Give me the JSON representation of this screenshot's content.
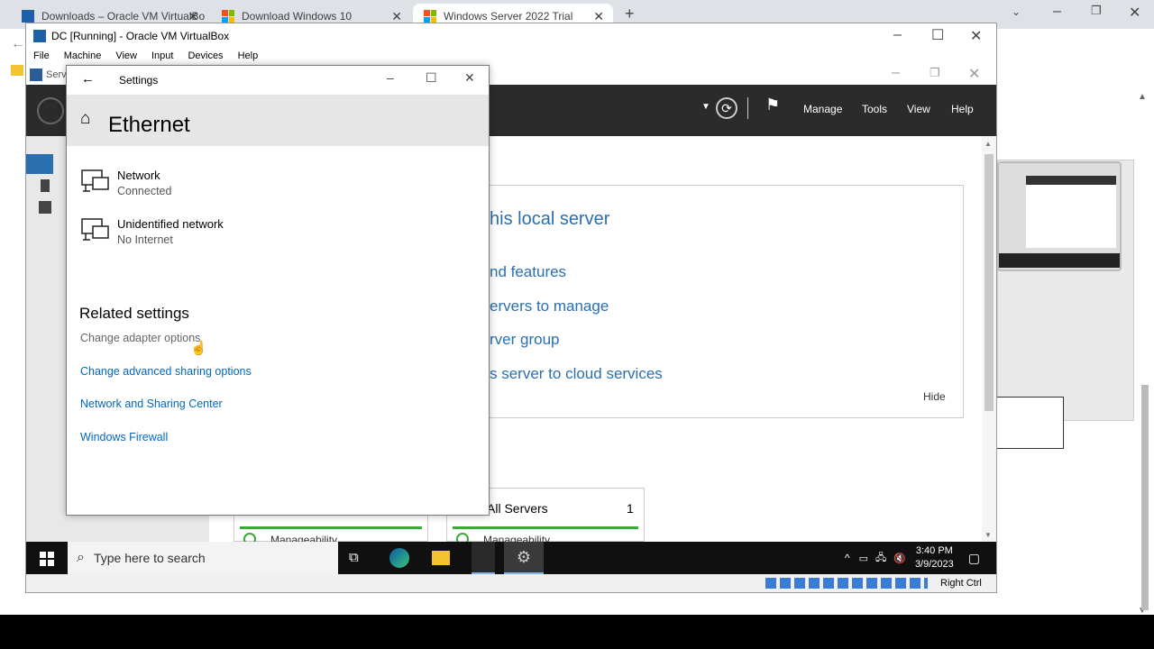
{
  "browser": {
    "tabs": [
      {
        "label": "Downloads – Oracle VM VirtualBo"
      },
      {
        "label": "Download Windows 10"
      },
      {
        "label": "Windows Server 2022 Trial"
      }
    ],
    "new_tab": "+"
  },
  "vbox": {
    "title": "DC [Running] - Oracle VM VirtualBox",
    "menu": [
      "File",
      "Machine",
      "View",
      "Input",
      "Devices",
      "Help"
    ],
    "host_key": "Right Ctrl"
  },
  "server_manager": {
    "title_fragment": "Serv",
    "nav": [
      "Manage",
      "Tools",
      "View",
      "Help"
    ],
    "welcome_links": [
      "his local server",
      "nd features",
      "ervers to manage",
      "rver group",
      "s server to cloud services"
    ],
    "hide": "Hide",
    "card_all_servers": "All Servers",
    "card_all_servers_count": "1",
    "card_manageability": "Manageability"
  },
  "settings": {
    "window_title": "Settings",
    "page_title": "Ethernet",
    "networks": [
      {
        "name": "Network",
        "status": "Connected"
      },
      {
        "name": "Unidentified network",
        "status": "No Internet"
      }
    ],
    "related_heading": "Related settings",
    "related_links": [
      "Change adapter options",
      "Change advanced sharing options",
      "Network and Sharing Center",
      "Windows Firewall"
    ]
  },
  "taskbar": {
    "search_placeholder": "Type here to search",
    "time": "3:40 PM",
    "date": "3/9/2023"
  }
}
